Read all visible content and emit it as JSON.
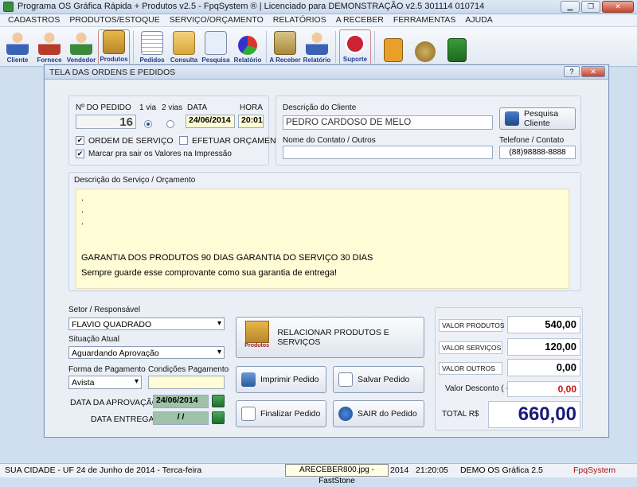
{
  "window": {
    "title": "Programa OS Gráfica Rápida + Produtos v2.5 - FpqSystem ® | Licenciado para  DEMONSTRAÇÃO v2.5 301114 010714"
  },
  "menu": [
    "CADASTROS",
    "PRODUTOS/ESTOQUE",
    "SERVIÇO/ORÇAMENTO",
    "RELATÓRIOS",
    "A RECEBER",
    "FERRAMENTAS",
    "AJUDA"
  ],
  "toolbar": {
    "cliente": "Cliente",
    "fornece": "Fornece",
    "vendedor": "Vendedor",
    "produtos": "Produtos",
    "pedidos": "Pedidos",
    "consulta": "Consulta",
    "pesquisa": "Pesquisa",
    "relatorio": "Relatório",
    "a_receber": "A Receber",
    "relatorio2": "Relatório",
    "suporte": "Suporte"
  },
  "dialog": {
    "title": "TELA DAS ORDENS E PEDIDOS",
    "order": {
      "number_label": "Nº DO PEDIDO",
      "number": "16",
      "via1_label": "1 via",
      "via2_label": "2 vias",
      "date_label": "DATA",
      "date": "24/06/2014",
      "time_label": "HORA",
      "time": "20:01",
      "ordem_servico": "ORDEM DE SERVIÇO",
      "efetuar_orcamento": "EFETUAR ORÇAMENTO",
      "marcar_valores": "Marcar pra sair os Valores na Impressão"
    },
    "client": {
      "desc_label": "Descrição do Cliente",
      "name": "PEDRO CARDOSO DE MELO",
      "search_button": "Pesquisa Cliente",
      "contact_label": "Nome do Contato / Outros",
      "contact": "",
      "phone_label": "Telefone / Contato",
      "phone": "(88)98888-8888"
    },
    "service": {
      "label": "Descrição do Serviço / Orçamento",
      "line1": ".",
      "line2": ".",
      "line3": ".",
      "guarantee": "GARANTIA DOS PRODUTOS 90 DIAS GARANTIA DO SERVIÇO 30 DIAS",
      "note": "Sempre guarde esse comprovante como sua garantia de entrega!"
    },
    "setor_label": "Setor / Responsável",
    "setor": "FLAVIO QUADRADO",
    "situacao_label": "Situação Atual",
    "situacao": "Aguardando Aprovação",
    "pagamento_label": "Forma de Pagamento",
    "pagamento": "Avista",
    "condicoes_label": "Condições Pagamento",
    "condicoes": "",
    "aprovacao_label": "DATA DA APROVAÇÃO",
    "aprovacao": "24/06/2014",
    "entrega_label": "DATA ENTREGA",
    "entrega": "/ /",
    "buttons": {
      "produtos_icon": "Produtos",
      "relacionar": "RELACIONAR PRODUTOS E SERVIÇOS",
      "imprimir": "Imprimir Pedido",
      "salvar": "Salvar Pedido",
      "finalizar": "Finalizar Pedido",
      "sair": "SAIR do Pedido"
    },
    "totals": {
      "produtos_label": "VALOR PRODUTOS",
      "produtos": "540,00",
      "servicos_label": "VALOR SERVIÇOS",
      "servicos": "120,00",
      "outros_label": "VALOR OUTROS",
      "outros": "0,00",
      "desconto_label": "Valor Desconto ( - )",
      "desconto": "0,00",
      "total_label": "TOTAL R$",
      "total": "660,00"
    }
  },
  "status": {
    "city": "SUA CIDADE - UF 24 de Junho de 2014 - Terca-feira",
    "tooltip": "ARECEBER800.jpg - FastStone",
    "year": "2014",
    "time": "21:20:05",
    "version": "DEMO OS Gráfica 2.5",
    "brand": "FpqSystem"
  }
}
